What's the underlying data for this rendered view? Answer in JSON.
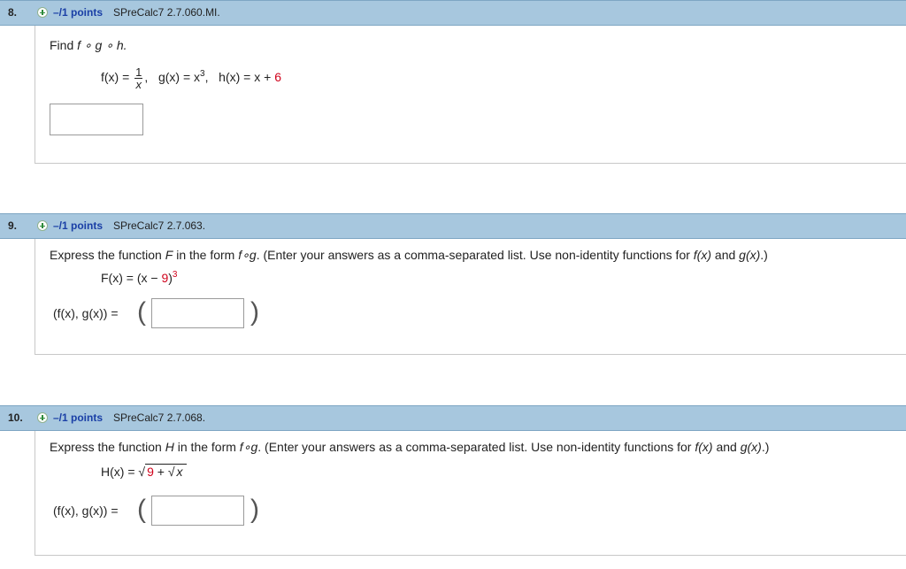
{
  "questions": [
    {
      "number": "8.",
      "points": "–/1 points",
      "source": "SPreCalc7 2.7.060.MI.",
      "prompt_prefix": "Find",
      "prompt_expr": "f ∘ g ∘ h.",
      "formula": {
        "f_label": "f(x) =",
        "f_num": "1",
        "f_den": "x",
        "sep1": ",",
        "g_label": "g(x) = x",
        "g_exp": "3",
        "sep2": ",",
        "h_label": "h(x) = x +",
        "h_const": "6"
      }
    },
    {
      "number": "9.",
      "points": "–/1 points",
      "source": "SPreCalc7 2.7.063.",
      "prompt_a": "Express the function",
      "prompt_var": "F",
      "prompt_b": "in the form",
      "prompt_form": "f∘g",
      "prompt_c": ". (Enter your answers as a comma-separated list. Use non-identity functions for",
      "prompt_fx": "f(x)",
      "prompt_and": "and",
      "prompt_gx": "g(x)",
      "prompt_end": ".)",
      "formula": {
        "label": "F(x) = (x −",
        "const": "9",
        "close": ")",
        "exp": "3"
      },
      "answer_label": "(f(x), g(x)) =",
      "paren_open": "(",
      "paren_close": ")"
    },
    {
      "number": "10.",
      "points": "–/1 points",
      "source": "SPreCalc7 2.7.068.",
      "prompt_a": "Express the function",
      "prompt_var": "H",
      "prompt_b": "in the form",
      "prompt_form": "f∘g",
      "prompt_c": ". (Enter your answers as a comma-separated list. Use non-identity functions for",
      "prompt_fx": "f(x)",
      "prompt_and": "and",
      "prompt_gx": "g(x)",
      "prompt_end": ".)",
      "formula": {
        "label": "H(x) =",
        "const": "9",
        "plus": "+",
        "inner": "x"
      },
      "answer_label": "(f(x), g(x)) =",
      "paren_open": "(",
      "paren_close": ")"
    }
  ],
  "colors": {
    "header_bg": "#a7c7de",
    "points_blue": "#1a3fa6",
    "constant_red": "#d0021b"
  },
  "icons": {
    "question_marker": "plus-circle-icon"
  }
}
